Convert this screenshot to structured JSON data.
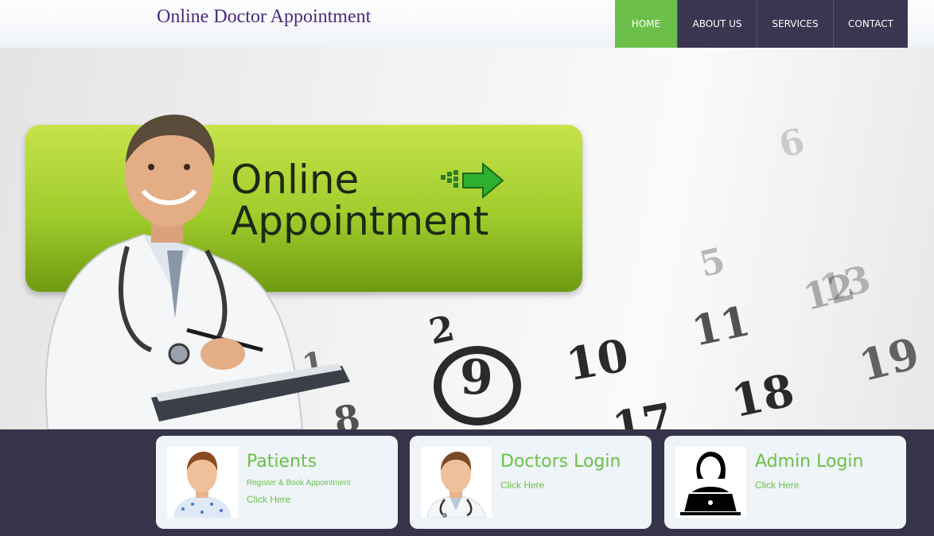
{
  "header": {
    "title": "Online Doctor Appointment",
    "nav": [
      {
        "label": "HOME",
        "active": true
      },
      {
        "label": "ABOUT US",
        "active": false
      },
      {
        "label": "SERVICES",
        "active": false
      },
      {
        "label": "CONTACT",
        "active": false
      }
    ]
  },
  "hero": {
    "line1": "Online",
    "line2": "Appointment",
    "calendar_numbers": [
      "2",
      "1",
      "9",
      "10",
      "11",
      "12",
      "13",
      "18",
      "17",
      "8",
      "19",
      "5",
      "6"
    ]
  },
  "cards": [
    {
      "title": "Patients",
      "subtitle": "Register & Book Appointment",
      "link": "Click Here",
      "icon": "patient-icon"
    },
    {
      "title": "Doctors Login",
      "link": "Click Here",
      "icon": "doctor-icon"
    },
    {
      "title": "Admin Login",
      "link": "Click Here",
      "icon": "admin-icon"
    }
  ],
  "colors": {
    "accent": "#6cc04a",
    "nav_bg": "#3a3550",
    "panel_bg": "#37334b",
    "title": "#4a2a80"
  }
}
